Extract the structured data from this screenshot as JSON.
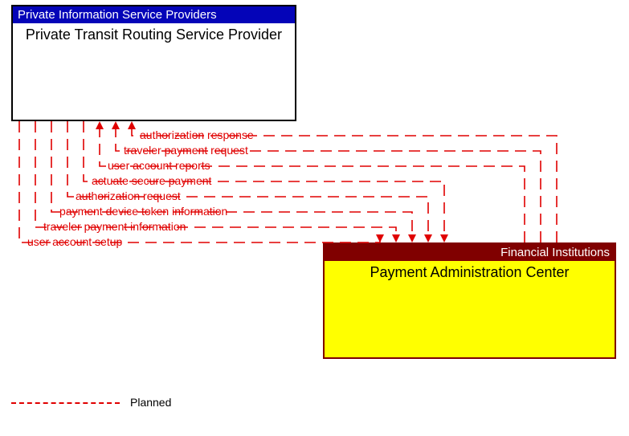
{
  "top_box": {
    "header": "Private Information Service Providers",
    "title": "Private Transit Routing Service Provider"
  },
  "bottom_box": {
    "header": "Financial Institutions",
    "title": "Payment Administration Center"
  },
  "flows": [
    {
      "label": "authorization response",
      "direction": "to_top",
      "xTop": 164,
      "xBot": 693,
      "yMid": 169,
      "labelX": 174
    },
    {
      "label": "traveler payment request",
      "direction": "to_top",
      "xTop": 144,
      "xBot": 673,
      "yMid": 188,
      "labelX": 154
    },
    {
      "label": "user account reports",
      "direction": "to_top",
      "xTop": 124,
      "xBot": 653,
      "yMid": 207,
      "labelX": 134
    },
    {
      "label": "actuate secure payment",
      "direction": "to_bottom",
      "xTop": 104,
      "xBot": 553,
      "yMid": 226,
      "labelX": 114
    },
    {
      "label": "authorization request",
      "direction": "to_bottom",
      "xTop": 84,
      "xBot": 533,
      "yMid": 245,
      "labelX": 94
    },
    {
      "label": "payment device token information",
      "direction": "to_bottom",
      "xTop": 64,
      "xBot": 513,
      "yMid": 264,
      "labelX": 74
    },
    {
      "label": "traveler payment information",
      "direction": "to_bottom",
      "xTop": 44,
      "xBot": 493,
      "yMid": 283,
      "labelX": 54
    },
    {
      "label": "user account setup",
      "direction": "to_bottom",
      "xTop": 24,
      "xBot": 473,
      "yMid": 302,
      "labelX": 34
    }
  ],
  "legend": {
    "label": "Planned"
  },
  "geom": {
    "topBottomY": 151,
    "botTopY": 302,
    "arrowHalf": 5,
    "arrowLen": 10
  }
}
